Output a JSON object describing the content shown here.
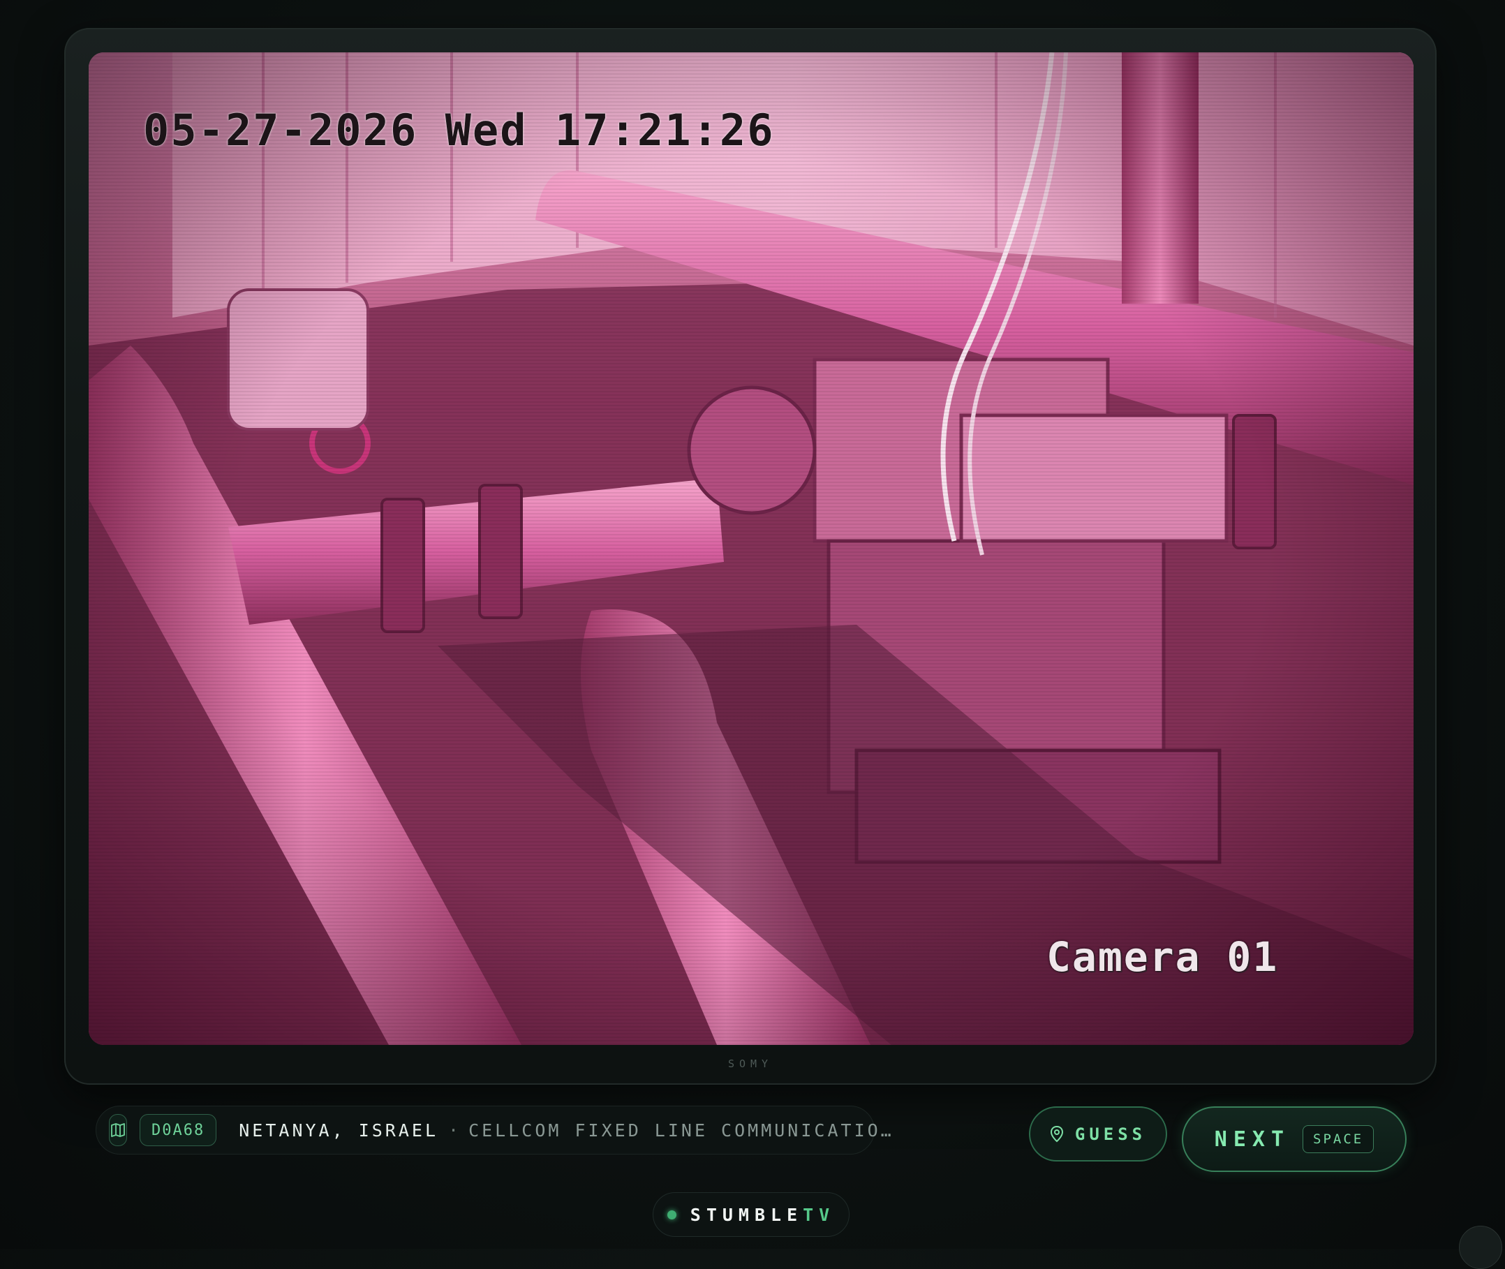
{
  "camera": {
    "timestamp": "05-27-2026 Wed 17:21:26",
    "camera_label": "Camera 01",
    "tint_color": "#c44d86"
  },
  "tv": {
    "brand": "SOMY"
  },
  "info": {
    "code": "D0A68",
    "location": "NETANYA, ISRAEL",
    "separator": "·",
    "isp": "CELLCOM FIXED LINE COMMUNICATIO…"
  },
  "actions": {
    "guess_label": "GUESS",
    "next_label": "NEXT",
    "next_shortcut": "SPACE"
  },
  "logo": {
    "part1": "STUMBLE",
    "part2": "TV",
    "accent": "#56c98a"
  }
}
